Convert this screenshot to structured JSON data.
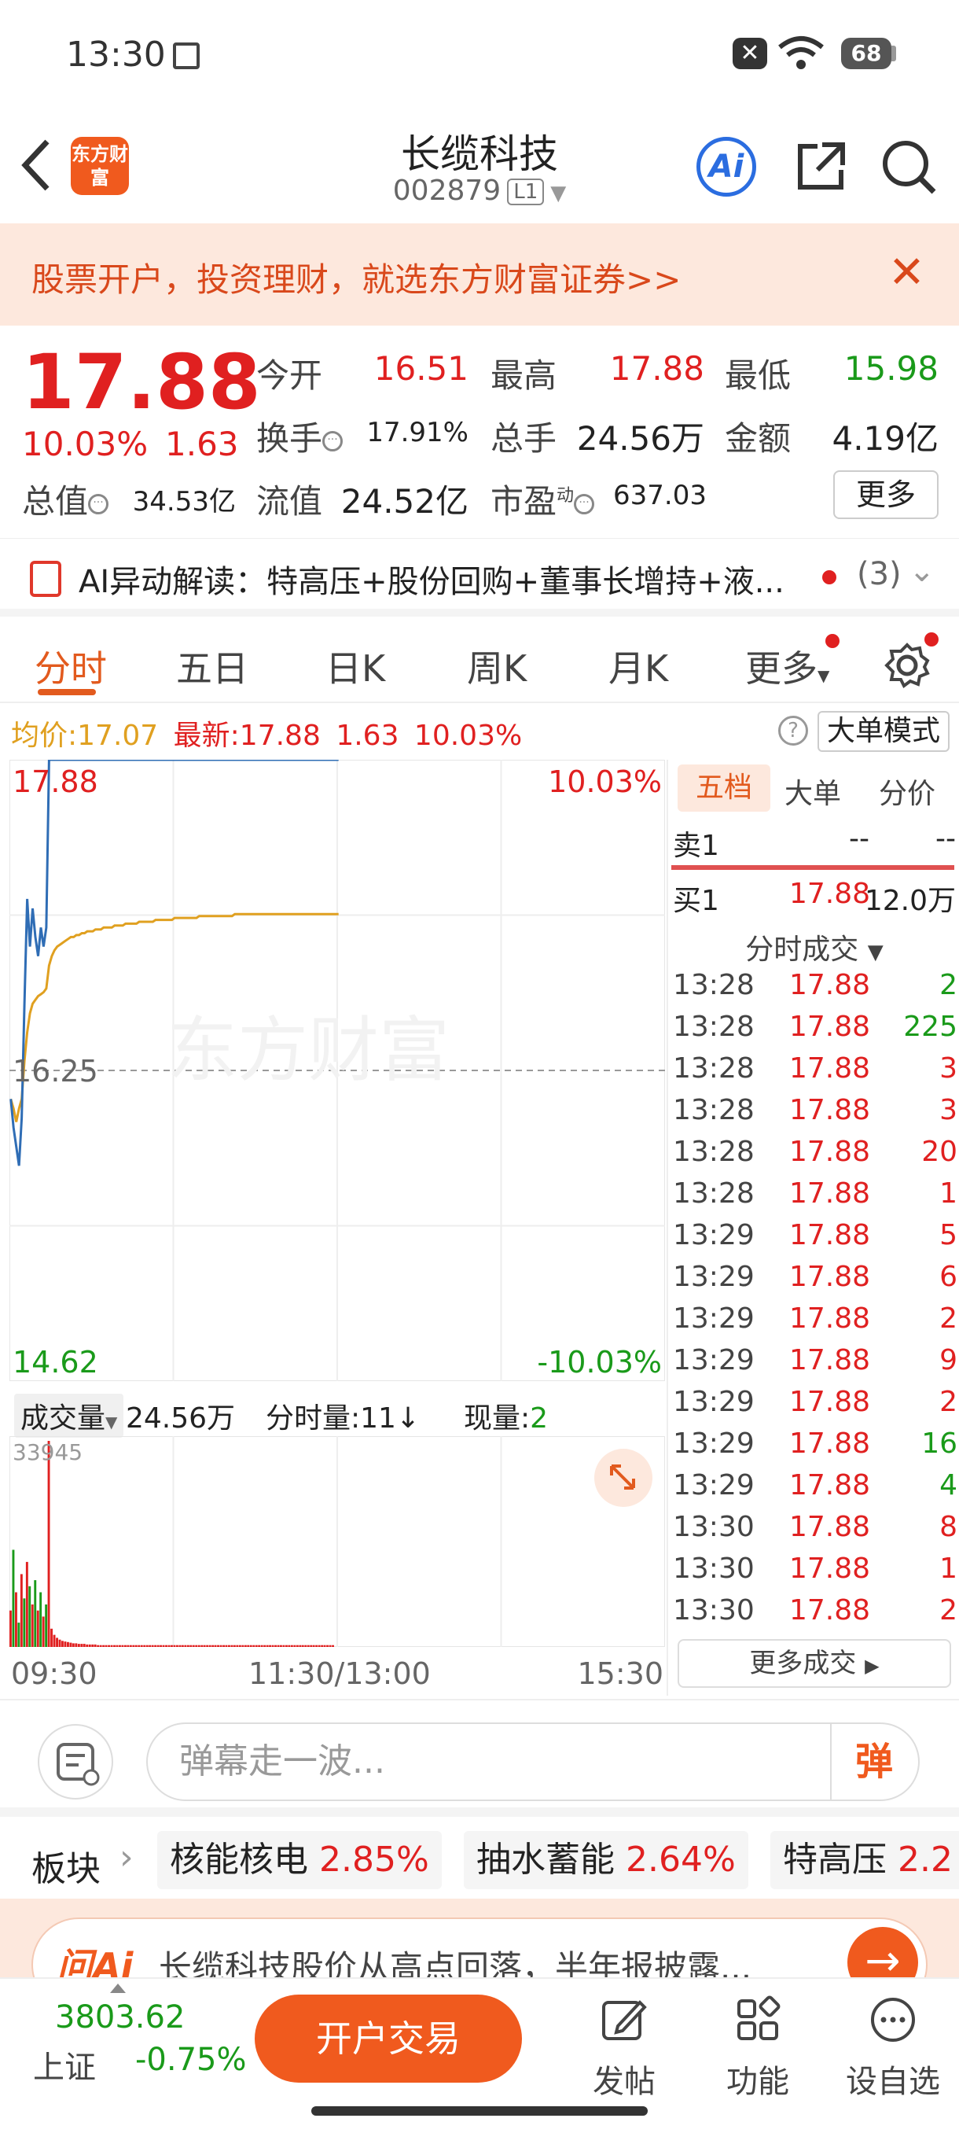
{
  "status": {
    "time": "13:30",
    "battery": "68"
  },
  "header": {
    "brand_logo": "东方财富",
    "stock_name": "长缆科技",
    "stock_code": "002879",
    "level": "L1",
    "ai_label": "Ai"
  },
  "promo": {
    "text": "股票开户，投资理财，就选东方财富证券>>"
  },
  "quote": {
    "price": "17.88",
    "change_pct": "10.03%",
    "change": "1.63",
    "open_label": "今开",
    "open": "16.51",
    "high_label": "最高",
    "high": "17.88",
    "low_label": "最低",
    "low": "15.98",
    "turnover_label": "换手",
    "turnover": "17.91%",
    "volume_label": "总手",
    "volume": "24.56万",
    "amount_label": "金额",
    "amount": "4.19亿",
    "mktcap_label": "总值",
    "mktcap": "34.53亿",
    "float_label": "流值",
    "float": "24.52亿",
    "pe_label": "市盈",
    "pe_sup": "动",
    "pe": "637.03",
    "more_label": "更多"
  },
  "ai_line": {
    "text": "AI异动解读：特高压+股份回购+董事长增持+液...",
    "count": "(3)"
  },
  "tabs": [
    "分时",
    "五日",
    "日K",
    "周K",
    "月K",
    "更多"
  ],
  "chart_info": {
    "avg_label": "均价:",
    "avg": "17.07",
    "latest_label": "最新:",
    "latest": "17.88",
    "latest_chg": "1.63",
    "latest_pct": "10.03%",
    "big_order_mode": "大单模式"
  },
  "chart_data": {
    "type": "line",
    "price_axis": {
      "top": "17.88",
      "mid": "16.25",
      "bottom": "14.62",
      "top_pct": "10.03%",
      "bottom_pct": "-10.03%",
      "ylim": [
        14.62,
        17.88
      ]
    },
    "x_labels": [
      "09:30",
      "11:30/13:00",
      "15:30"
    ],
    "total_minutes": 240,
    "series": [
      {
        "values": [
          16.1,
          15.95,
          15.85,
          15.75,
          16.0,
          16.6,
          17.15,
          16.9,
          17.1,
          16.95,
          16.85,
          17.0,
          16.9,
          17.0,
          17.88,
          17.88,
          17.88,
          17.88,
          17.88,
          17.88,
          17.88,
          17.88,
          17.88,
          17.88,
          17.88,
          17.88,
          17.88,
          17.88,
          17.88,
          17.88,
          17.88,
          17.88,
          17.88,
          17.88,
          17.88,
          17.88,
          17.88,
          17.88,
          17.88,
          17.88,
          17.88,
          17.88,
          17.88,
          17.88,
          17.88,
          17.88,
          17.88,
          17.88,
          17.88,
          17.88,
          17.88,
          17.88,
          17.88,
          17.88,
          17.88,
          17.88,
          17.88,
          17.88,
          17.88,
          17.88,
          17.88,
          17.88,
          17.88,
          17.88,
          17.88,
          17.88,
          17.88,
          17.88,
          17.88,
          17.88,
          17.88,
          17.88,
          17.88,
          17.88,
          17.88,
          17.88,
          17.88,
          17.88,
          17.88,
          17.88,
          17.88,
          17.88,
          17.88,
          17.88,
          17.88,
          17.88,
          17.88,
          17.88,
          17.88,
          17.88,
          17.88,
          17.88,
          17.88,
          17.88,
          17.88,
          17.88,
          17.88,
          17.88,
          17.88,
          17.88,
          17.88,
          17.88,
          17.88,
          17.88,
          17.88,
          17.88,
          17.88,
          17.88,
          17.88,
          17.88,
          17.88,
          17.88,
          17.88,
          17.88,
          17.88,
          17.88,
          17.88,
          17.88,
          17.88,
          17.88,
          17.88
        ]
      },
      {
        "values": [
          16.1,
          16.05,
          15.98,
          16.05,
          16.1,
          16.3,
          16.45,
          16.55,
          16.6,
          16.62,
          16.64,
          16.65,
          16.66,
          16.68,
          16.8,
          16.85,
          16.88,
          16.9,
          16.91,
          16.92,
          16.93,
          16.94,
          16.95,
          16.95,
          16.96,
          16.96,
          16.97,
          16.97,
          16.98,
          16.98,
          16.98,
          16.99,
          16.99,
          16.99,
          17.0,
          17.0,
          17.0,
          17.0,
          17.01,
          17.01,
          17.01,
          17.01,
          17.02,
          17.02,
          17.02,
          17.02,
          17.02,
          17.03,
          17.03,
          17.03,
          17.03,
          17.03,
          17.03,
          17.04,
          17.04,
          17.04,
          17.04,
          17.04,
          17.04,
          17.04,
          17.05,
          17.05,
          17.05,
          17.05,
          17.05,
          17.05,
          17.05,
          17.05,
          17.05,
          17.06,
          17.06,
          17.06,
          17.06,
          17.06,
          17.06,
          17.06,
          17.06,
          17.06,
          17.06,
          17.06,
          17.06,
          17.06,
          17.07,
          17.07,
          17.07,
          17.07,
          17.07,
          17.07,
          17.07,
          17.07,
          17.07,
          17.07,
          17.07,
          17.07,
          17.07,
          17.07,
          17.07,
          17.07,
          17.07,
          17.07,
          17.07,
          17.07,
          17.07,
          17.07,
          17.07,
          17.07,
          17.07,
          17.07,
          17.07,
          17.07,
          17.07,
          17.07,
          17.07,
          17.07,
          17.07,
          17.07,
          17.07,
          17.07,
          17.07,
          17.07,
          17.07
        ]
      }
    ],
    "volume": {
      "max_label": "33945",
      "ylim": [
        0,
        33945
      ],
      "values": [
        6000,
        16000,
        9000,
        4000,
        12000,
        8000,
        14000,
        10000,
        7000,
        11000,
        6000,
        9000,
        5000,
        7000,
        33945,
        3000,
        2000,
        1500,
        1200,
        1000,
        900,
        800,
        700,
        600,
        600,
        500,
        500,
        500,
        400,
        400,
        400,
        400,
        300,
        300,
        300,
        300,
        300,
        300,
        300,
        300,
        300,
        300,
        300,
        300,
        300,
        300,
        300,
        300,
        300,
        300,
        300,
        300,
        300,
        300,
        300,
        300,
        300,
        300,
        300,
        300,
        300,
        300,
        300,
        300,
        300,
        300,
        300,
        300,
        300,
        300,
        300,
        300,
        300,
        300,
        300,
        300,
        300,
        300,
        300,
        300,
        300,
        300,
        300,
        300,
        300,
        300,
        300,
        300,
        300,
        300,
        300,
        300,
        300,
        300,
        300,
        300,
        300,
        300,
        300,
        300,
        300,
        300,
        300,
        300,
        300,
        300,
        300,
        300,
        300,
        300,
        300,
        300,
        300,
        300,
        300,
        300,
        300,
        300,
        300
      ],
      "color_pattern": [
        "red",
        "green",
        "red",
        "green",
        "red",
        "green",
        "red",
        "green",
        "red",
        "green",
        "red",
        "green",
        "red",
        "green",
        "red"
      ],
      "header_label": "成交量",
      "header_total": "24.56万",
      "minute_label": "分时量:11",
      "current_label": "现量:",
      "current": "2"
    },
    "colors": {
      "price": "#2f6db5",
      "avg": "#e0a020",
      "up": "#e02020",
      "down": "#1a9a1a"
    }
  },
  "right_panel": {
    "tabs": [
      "五档",
      "大单",
      "分价"
    ],
    "sell1": {
      "label": "卖1",
      "price": "--",
      "vol": "--"
    },
    "buy1": {
      "label": "买1",
      "price": "17.88",
      "vol": "12.0万"
    },
    "subheader": "分时成交",
    "trades": [
      {
        "t": "13:28",
        "p": "17.88",
        "v": "2",
        "vc": "green"
      },
      {
        "t": "13:28",
        "p": "17.88",
        "v": "225",
        "vc": "green"
      },
      {
        "t": "13:28",
        "p": "17.88",
        "v": "3",
        "vc": "red"
      },
      {
        "t": "13:28",
        "p": "17.88",
        "v": "3",
        "vc": "red"
      },
      {
        "t": "13:28",
        "p": "17.88",
        "v": "20",
        "vc": "red"
      },
      {
        "t": "13:28",
        "p": "17.88",
        "v": "1",
        "vc": "red"
      },
      {
        "t": "13:29",
        "p": "17.88",
        "v": "5",
        "vc": "red"
      },
      {
        "t": "13:29",
        "p": "17.88",
        "v": "6",
        "vc": "red"
      },
      {
        "t": "13:29",
        "p": "17.88",
        "v": "2",
        "vc": "red"
      },
      {
        "t": "13:29",
        "p": "17.88",
        "v": "9",
        "vc": "red"
      },
      {
        "t": "13:29",
        "p": "17.88",
        "v": "2",
        "vc": "red"
      },
      {
        "t": "13:29",
        "p": "17.88",
        "v": "16",
        "vc": "green"
      },
      {
        "t": "13:29",
        "p": "17.88",
        "v": "4",
        "vc": "green"
      },
      {
        "t": "13:30",
        "p": "17.88",
        "v": "8",
        "vc": "red"
      },
      {
        "t": "13:30",
        "p": "17.88",
        "v": "1",
        "vc": "red"
      },
      {
        "t": "13:30",
        "p": "17.88",
        "v": "2",
        "vc": "red"
      }
    ],
    "more_trades": "更多成交"
  },
  "comment": {
    "placeholder": "弹幕走一波...",
    "danmaku_btn": "弹"
  },
  "sectors": {
    "label": "板块",
    "items": [
      {
        "name": "核能核电",
        "pct": "2.85%"
      },
      {
        "name": "抽水蓄能",
        "pct": "2.64%"
      },
      {
        "name": "特高压",
        "pct": "2.2"
      }
    ]
  },
  "askai": {
    "logo": "问Ai",
    "text": "长缆科技股价从高点回落，半年报披露..."
  },
  "bottom": {
    "index_value": "3803.62",
    "index_name": "上证",
    "index_change": "-0.75%",
    "trade_button": "开户交易",
    "nav": [
      "发帖",
      "功能",
      "设自选"
    ]
  }
}
